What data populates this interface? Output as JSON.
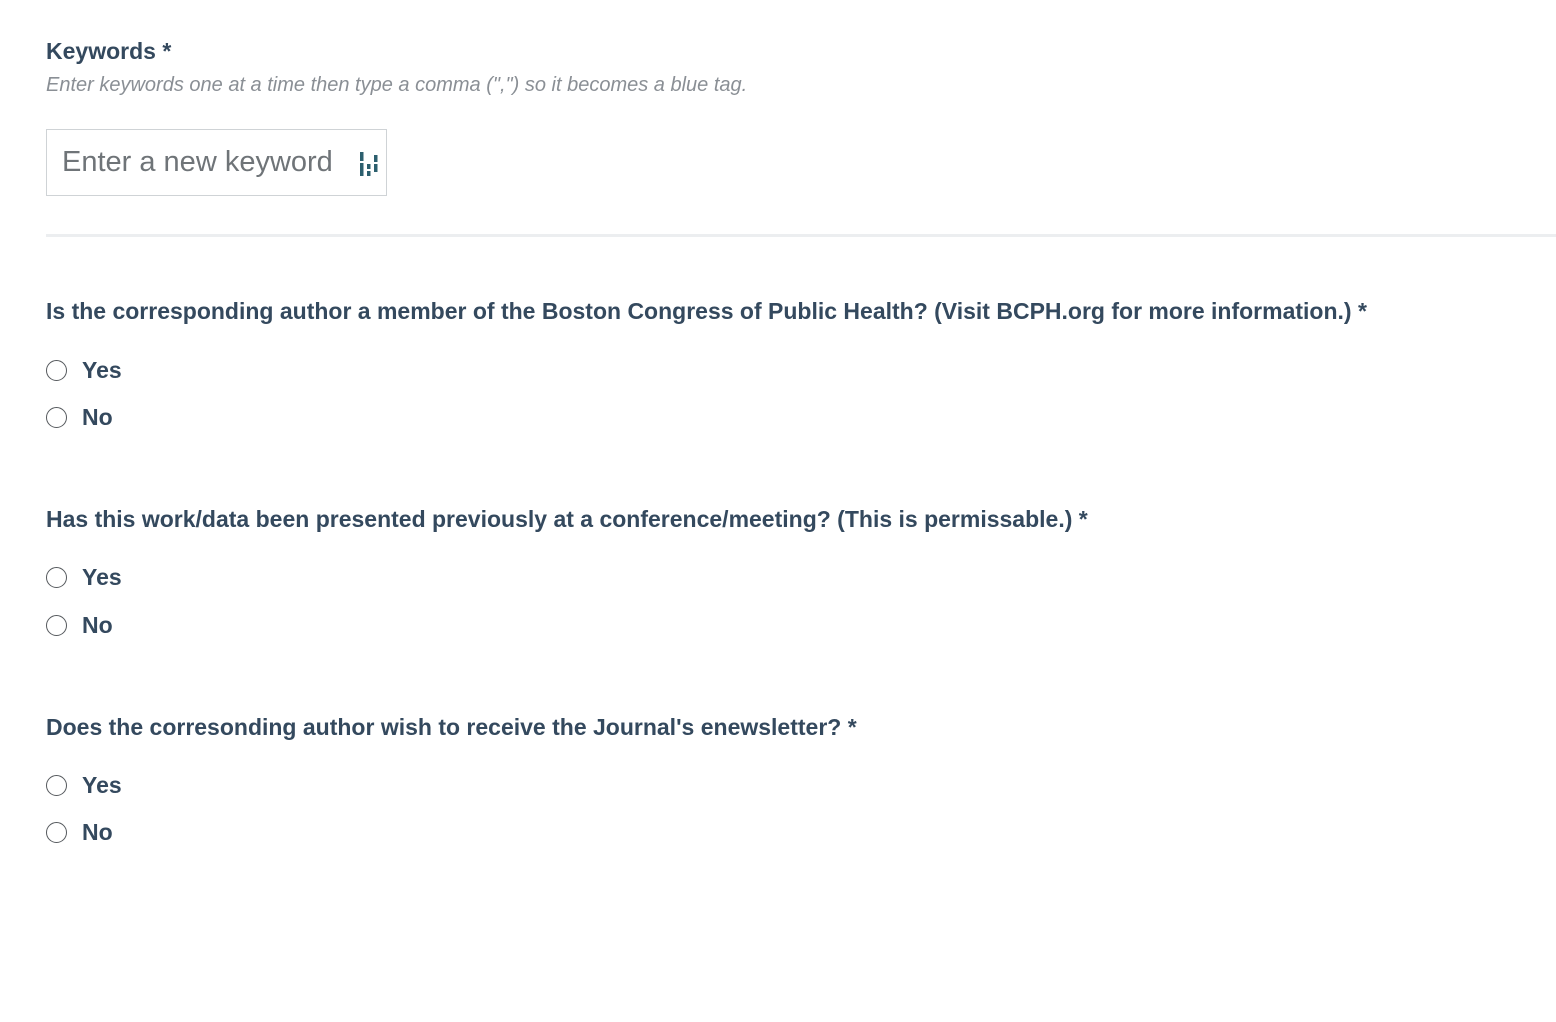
{
  "keywords": {
    "label": "Keywords *",
    "hint": "Enter keywords one at a time then type a comma (\",\") so it becomes a blue tag.",
    "input_placeholder": "Enter a new keyword",
    "extension_icon": "password-manager-icon"
  },
  "questions": [
    {
      "label": "Is the corresponding author a member of the Boston Congress of Public Health? (Visit BCPH.org for more information.) *",
      "options": [
        "Yes",
        "No"
      ]
    },
    {
      "label": "Has this work/data been presented previously at a conference/meeting? (This is permissable.) *",
      "options": [
        "Yes",
        "No"
      ]
    },
    {
      "label": "Does the corresonding author wish to receive the Journal's enewsletter? *",
      "options": [
        "Yes",
        "No"
      ]
    }
  ],
  "colors": {
    "text": "#34495e",
    "hint": "#8a8f95",
    "icon_accent": "#2c5f6e"
  }
}
